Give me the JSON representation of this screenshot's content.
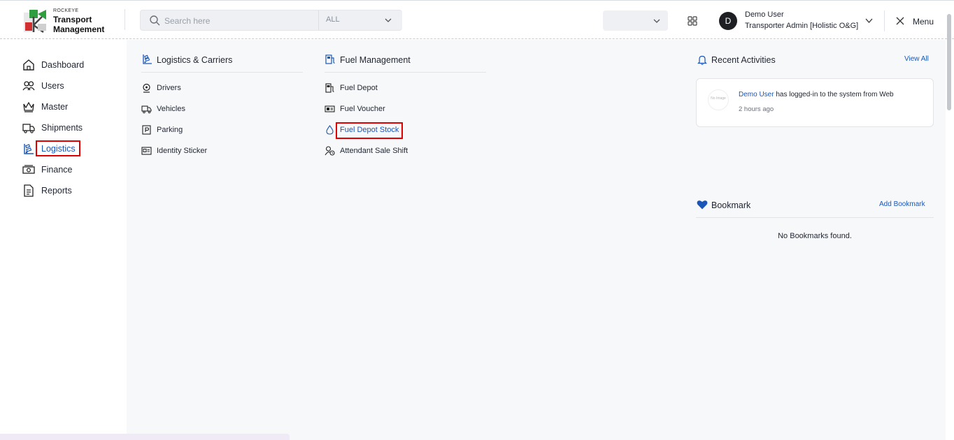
{
  "header": {
    "brand_small": "ROCKEYE",
    "brand_line1": "Transport",
    "brand_line2": "Management",
    "search_placeholder": "Search here",
    "search_scope": "ALL",
    "user_initial": "D",
    "user_name": "Demo User",
    "user_role": "Transporter Admin [Holistic O&G]",
    "menu_label": "Menu"
  },
  "sidebar": {
    "items": [
      {
        "label": "Dashboard",
        "icon": "home-icon"
      },
      {
        "label": "Users",
        "icon": "users-icon"
      },
      {
        "label": "Master",
        "icon": "crown-icon"
      },
      {
        "label": "Shipments",
        "icon": "truck-icon"
      },
      {
        "label": "Logistics",
        "icon": "logistics-icon",
        "active": true
      },
      {
        "label": "Finance",
        "icon": "money-icon"
      },
      {
        "label": "Reports",
        "icon": "report-icon"
      }
    ]
  },
  "mega_menu": {
    "logistics": {
      "title": "Logistics & Carriers",
      "items": [
        "Drivers",
        "Vehicles",
        "Parking",
        "Identity Sticker"
      ]
    },
    "fuel": {
      "title": "Fuel Management",
      "items": [
        "Fuel Depot",
        "Fuel Voucher",
        "Fuel Depot Stock",
        "Attendant Sale Shift"
      ]
    }
  },
  "activities": {
    "title": "Recent Activities",
    "view_all": "View All",
    "no_image": "No Image",
    "entry_user": "Demo User",
    "entry_text": " has logged-in to the system from Web",
    "entry_time": "2 hours ago"
  },
  "bookmarks": {
    "title": "Bookmark",
    "add_label": "Add Bookmark",
    "empty_text": "No Bookmarks found."
  },
  "colors": {
    "accent": "#1a56b8",
    "highlight": "#e00000",
    "panel_bg": "#f7f8fa"
  }
}
